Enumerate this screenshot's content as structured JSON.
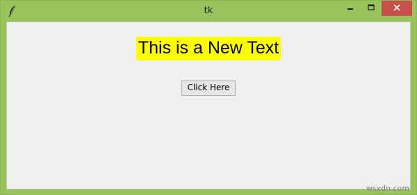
{
  "window": {
    "title": "tk",
    "frame_color": "#98c35d",
    "close_button_color": "#c7504a",
    "app_icon": "tk-feather-icon",
    "controls": {
      "minimize_icon": "minimize-icon",
      "maximize_icon": "maximize-icon",
      "close_icon": "close-icon"
    }
  },
  "content": {
    "label_text": "This is a New Text",
    "label_bg_color": "#ffff00",
    "button_label": "Click Here"
  },
  "watermark": "wsxdn.com"
}
